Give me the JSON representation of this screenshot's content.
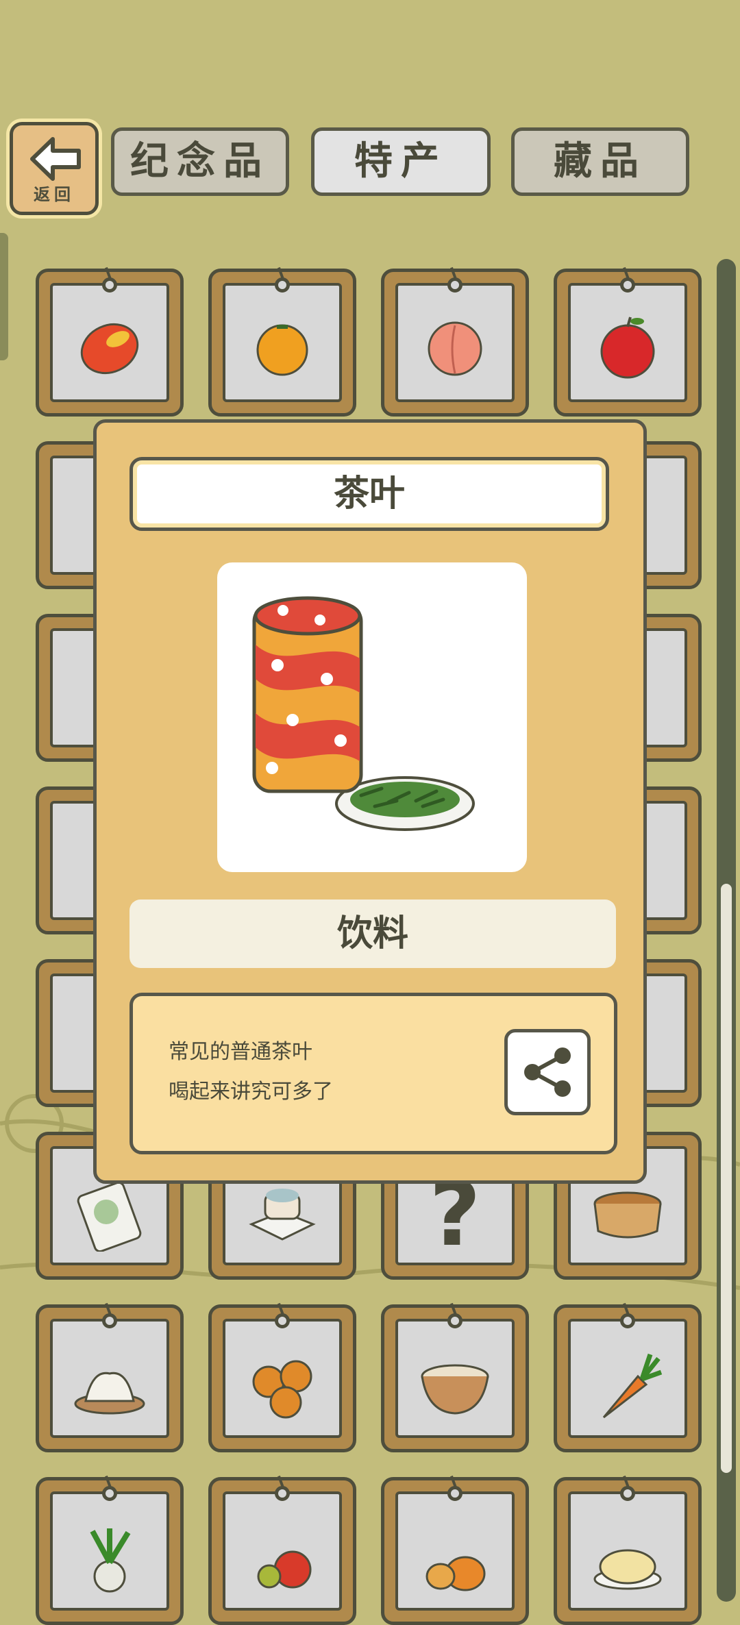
{
  "back_button": {
    "label": "返回"
  },
  "tabs": [
    {
      "label": "纪念品",
      "active": false
    },
    {
      "label": "特产",
      "active": true
    },
    {
      "label": "藏品",
      "active": false
    }
  ],
  "grid_items": [
    {
      "icon": "mango-icon"
    },
    {
      "icon": "orange-icon"
    },
    {
      "icon": "peach-icon"
    },
    {
      "icon": "apple-icon"
    },
    {
      "icon": "unknown-icon",
      "label": "?"
    },
    {
      "icon": "rice-bag-icon"
    },
    {
      "icon": "mochi-plate-icon"
    },
    {
      "icon": "unknown-icon",
      "label": "?"
    },
    {
      "icon": "basket-icon"
    },
    {
      "icon": "dumplings-icon"
    },
    {
      "icon": "egg-tarts-icon"
    },
    {
      "icon": "porridge-bowl-icon"
    },
    {
      "icon": "carrot-icon"
    },
    {
      "icon": "radish-icon"
    },
    {
      "icon": "tomatoes-icon"
    },
    {
      "icon": "pumpkins-icon"
    },
    {
      "icon": "cabbage-salad-icon"
    }
  ],
  "modal": {
    "title": "茶叶",
    "image": "tea-can-and-leaves-image",
    "category": "饮料",
    "description": [
      "常见的普通茶叶",
      "喝起来讲究可多了"
    ],
    "share_icon": "share-icon"
  },
  "colors": {
    "background": "#c3bd7c",
    "modal_bg": "#e8c37a",
    "desc_bg": "#fadfa1",
    "text": "#4a4a3a"
  }
}
